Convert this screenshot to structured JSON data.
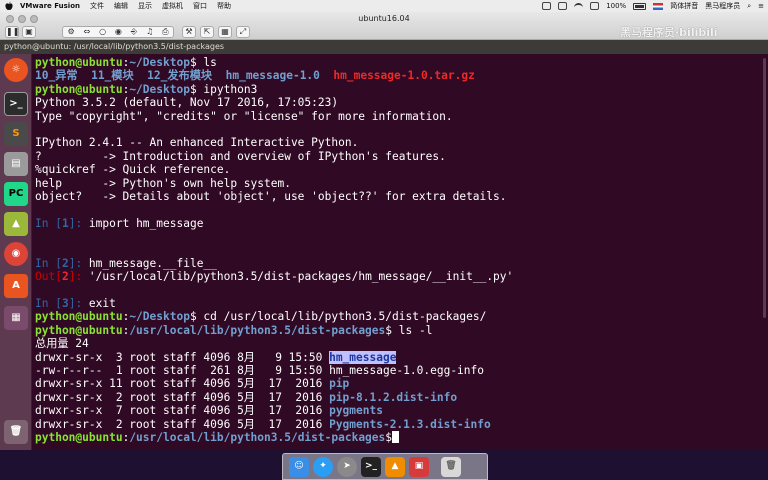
{
  "mac_menubar": {
    "app_name": "VMware Fusion",
    "menus": [
      "文件",
      "编辑",
      "显示",
      "虚拟机",
      "窗口",
      "帮助"
    ],
    "battery": "100%",
    "input_method": "简体拼音",
    "user": "黑马程序员"
  },
  "vm_window": {
    "title": "ubuntu16.04",
    "watermark": "黑马程序员·bilibili"
  },
  "ubuntu_panel": {
    "title": "python@ubuntu: /usr/local/lib/python3.5/dist-packages"
  },
  "terminal": {
    "prompt_user": "python@ubuntu",
    "paths": {
      "desktop": "~/Desktop",
      "dist": "/usr/local/lib/python3.5/dist-packages"
    },
    "cmd_ls": "ls",
    "ls_items": [
      "10_异常",
      "11_模块",
      "12_发布模块",
      "hm_message-1.0",
      "hm_message-1.0.tar.gz"
    ],
    "cmd_ipython": "ipython3",
    "python_version": "Python 3.5.2 (default, Nov 17 2016, 17:05:23)",
    "python_help": "Type \"copyright\", \"credits\" or \"license\" for more information.",
    "ipython_version": "IPython 2.4.1 -- An enhanced Interactive Python.",
    "help_lines": [
      "?         -> Introduction and overview of IPython's features.",
      "%quickref -> Quick reference.",
      "help      -> Python's own help system.",
      "object?   -> Details about 'object', use 'object??' for extra details."
    ],
    "in1_label": "In [",
    "in1_num": "1",
    "in1_close": "]: ",
    "in1_code": "import hm_message",
    "in2_num": "2",
    "in2_code": "hm_message.__file__",
    "out2_label": "Out[",
    "out2_num": "2",
    "out2_close": "]: ",
    "out2_value": "'/usr/local/lib/python3.5/dist-packages/hm_message/__init__.py'",
    "in3_num": "3",
    "in3_code": "exit",
    "cmd_cd": "cd /usr/local/lib/python3.5/dist-packages/",
    "cmd_lsl": "ls -l",
    "total": "总用量 24",
    "listing": [
      {
        "meta": "drwxr-sr-x  3 root staff 4096 8月   9 15:50 ",
        "name": "hm_message",
        "kind": "dir-highlight"
      },
      {
        "meta": "-rw-r--r--  1 root staff  261 8月   9 15:50 ",
        "name": "hm_message-1.0.egg-info",
        "kind": "file"
      },
      {
        "meta": "drwxr-sr-x 11 root staff 4096 5月  17  2016 ",
        "name": "pip",
        "kind": "dir"
      },
      {
        "meta": "drwxr-sr-x  2 root staff 4096 5月  17  2016 ",
        "name": "pip-8.1.2.dist-info",
        "kind": "dir"
      },
      {
        "meta": "drwxr-sr-x  7 root staff 4096 5月  17  2016 ",
        "name": "pygments",
        "kind": "dir"
      },
      {
        "meta": "drwxr-sr-x  2 root staff 4096 5月  17  2016 ",
        "name": "Pygments-2.1.3.dist-info",
        "kind": "dir"
      }
    ]
  },
  "launcher_items": [
    "ubuntu-dash",
    "terminal",
    "sublime-text",
    "files",
    "pycharm",
    "installer",
    "chrome",
    "software-center",
    "workspaces",
    "trash"
  ],
  "dock_items": [
    "finder",
    "safari",
    "launchpad",
    "terminal",
    "vlc",
    "vmware",
    "trash"
  ]
}
